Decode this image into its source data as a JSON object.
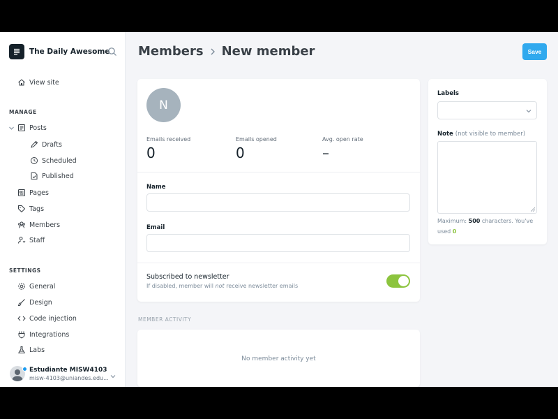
{
  "sidebar": {
    "brand": "The Daily Awesome",
    "top_items": [
      {
        "label": "View site",
        "icon": "home-icon"
      }
    ],
    "manage_heading": "MANAGE",
    "manage_items": [
      {
        "label": "Posts",
        "icon": "posts-icon"
      },
      {
        "label": "Drafts",
        "icon": "pencil-icon"
      },
      {
        "label": "Scheduled",
        "icon": "clock-icon"
      },
      {
        "label": "Published",
        "icon": "published-icon"
      },
      {
        "label": "Pages",
        "icon": "pages-icon"
      },
      {
        "label": "Tags",
        "icon": "tag-icon"
      },
      {
        "label": "Members",
        "icon": "members-icon"
      },
      {
        "label": "Staff",
        "icon": "staff-icon"
      }
    ],
    "settings_heading": "SETTINGS",
    "settings_items": [
      {
        "label": "General",
        "icon": "gear-icon"
      },
      {
        "label": "Design",
        "icon": "brush-icon"
      },
      {
        "label": "Code injection",
        "icon": "code-icon"
      },
      {
        "label": "Integrations",
        "icon": "integrations-icon"
      },
      {
        "label": "Labs",
        "icon": "flask-icon"
      }
    ],
    "user": {
      "name": "Estudiante MISW4103",
      "email": "misw-4103@uniandes.edu..."
    }
  },
  "header": {
    "breadcrumb": [
      "Members",
      "New member"
    ],
    "save_label": "Save"
  },
  "member": {
    "avatar_initial": "N",
    "stats": [
      {
        "label": "Emails received",
        "value": "0"
      },
      {
        "label": "Emails opened",
        "value": "0"
      },
      {
        "label": "Avg. open rate",
        "value": "–"
      }
    ],
    "name_label": "Name",
    "name_value": "",
    "email_label": "Email",
    "email_value": "",
    "newsletter_title": "Subscribed to newsletter",
    "newsletter_desc_before": "If disabled, member will ",
    "newsletter_desc_em": "not",
    "newsletter_desc_after": " receive newsletter emails",
    "newsletter_enabled": true
  },
  "side_panel": {
    "labels_label": "Labels",
    "labels_value": "",
    "note_label": "Note",
    "note_hint": "(not visible to member)",
    "note_value": "",
    "help_prefix": "Maximum: ",
    "help_max": "500",
    "help_middle": " characters. You've used ",
    "help_used": "0"
  },
  "activity": {
    "heading": "MEMBER ACTIVITY",
    "empty": "No member activity yet"
  },
  "colors": {
    "accent": "#30a9ee",
    "toggle_on": "#8cc43e",
    "sidebar_bg": "#ffffff",
    "main_bg": "#f4f5f8"
  }
}
